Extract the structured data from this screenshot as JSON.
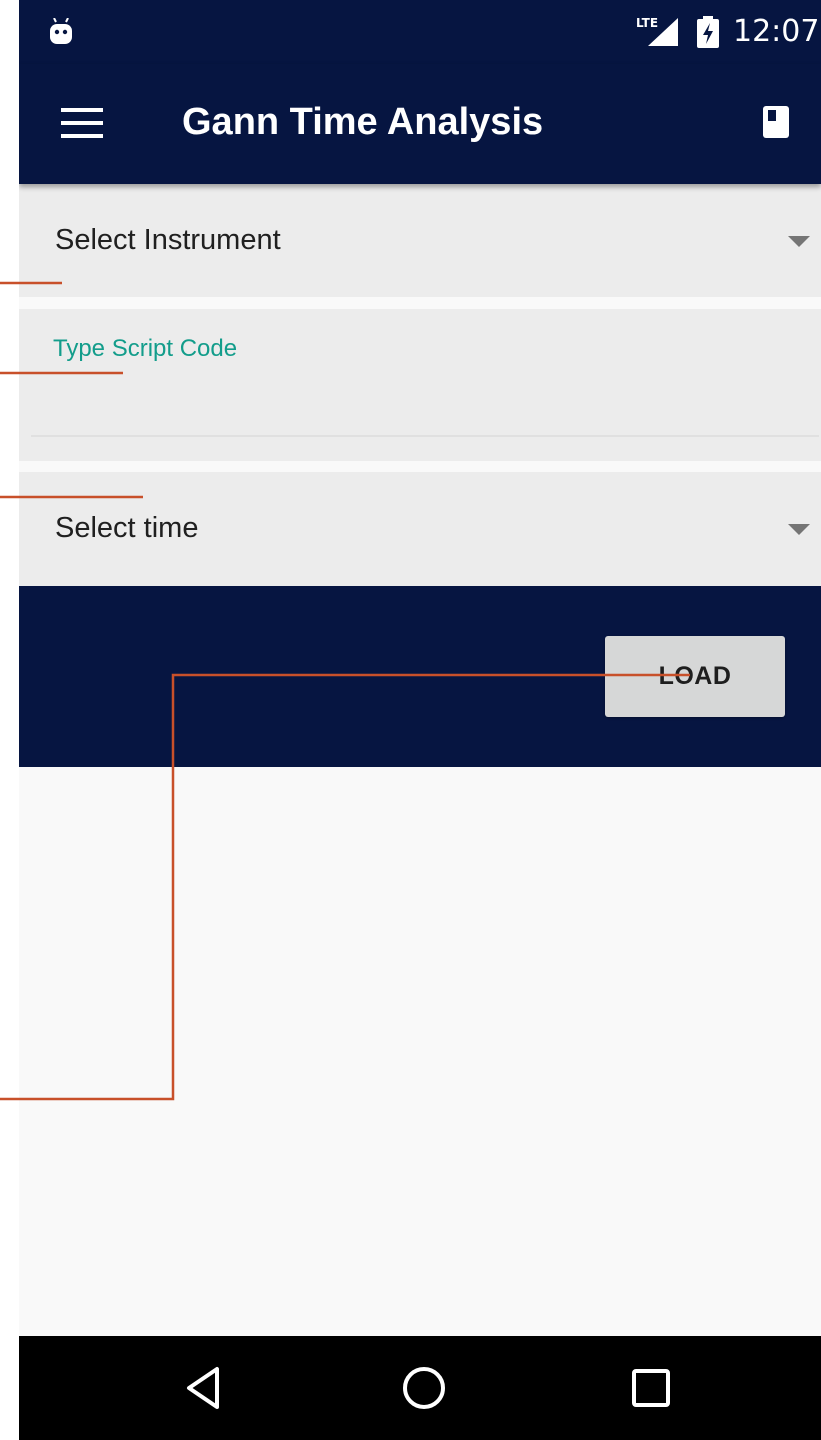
{
  "status_bar": {
    "network_label": "LTE",
    "time": "12:07"
  },
  "app_bar": {
    "title": "Gann Time Analysis"
  },
  "form": {
    "instrument_spinner": {
      "text": "Select Instrument"
    },
    "script_code": {
      "label": "Type Script Code",
      "value": ""
    },
    "time_spinner": {
      "text": "Select time"
    },
    "load_button_label": "LOAD"
  },
  "colors": {
    "primary_dark": "#061541",
    "accent": "#139d8b",
    "field_background": "#ececec",
    "content_background": "#f9f9f9",
    "button_background": "#d6d7d7",
    "annotation_line": "#c8502a"
  },
  "icons": {
    "status_left": "android-debug-icon",
    "signal": "lte-signal-icon",
    "battery": "battery-charging-icon",
    "menu": "hamburger-menu-icon",
    "app_bar_action": "book-icon",
    "spinner": "dropdown-caret-icon",
    "nav_back": "back-triangle-icon",
    "nav_home": "home-circle-icon",
    "nav_recents": "recents-square-icon"
  }
}
